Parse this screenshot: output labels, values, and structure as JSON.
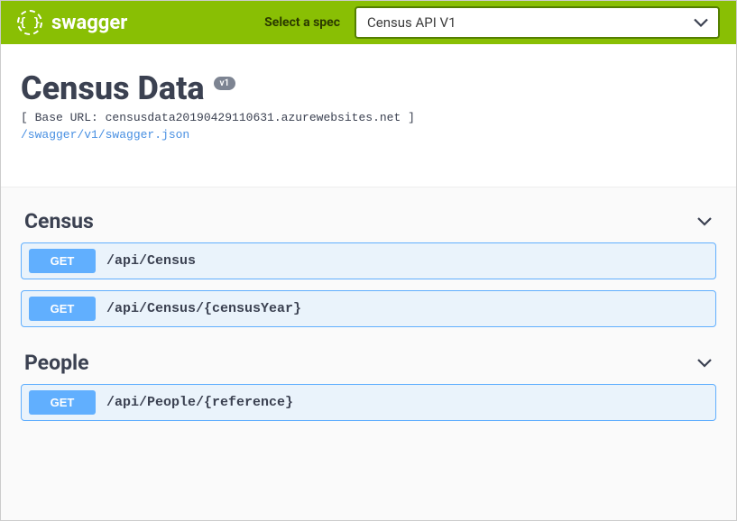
{
  "topbar": {
    "logo_text": "swagger",
    "select_label": "Select a spec",
    "selected_spec": "Census API V1"
  },
  "info": {
    "title": "Census Data",
    "version_badge": "v1",
    "base_url_line": "[ Base URL: censusdata20190429110631.azurewebsites.net ]",
    "swagger_link": "/swagger/v1/swagger.json"
  },
  "tags": [
    {
      "name": "Census",
      "ops": [
        {
          "method": "GET",
          "path": "/api/Census"
        },
        {
          "method": "GET",
          "path": "/api/Census/{censusYear}"
        }
      ]
    },
    {
      "name": "People",
      "ops": [
        {
          "method": "GET",
          "path": "/api/People/{reference}"
        }
      ]
    }
  ]
}
